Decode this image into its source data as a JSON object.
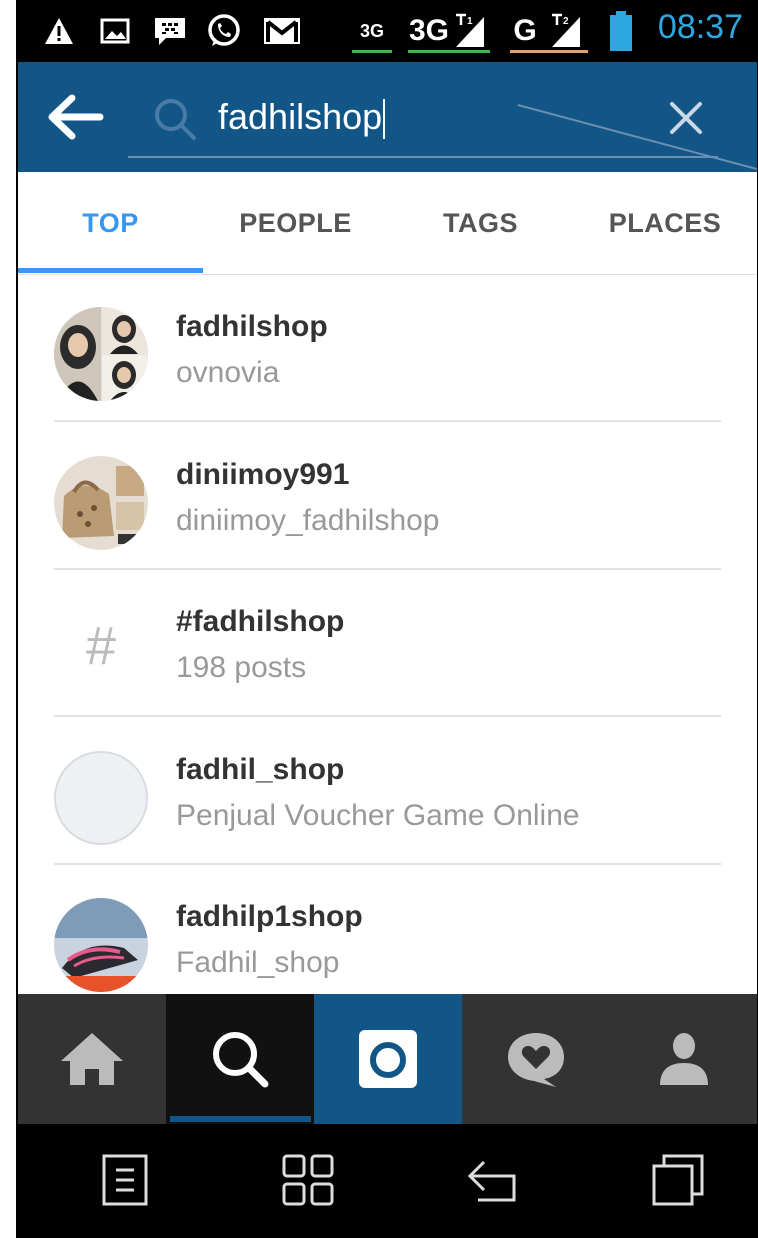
{
  "status_bar": {
    "network_labels": [
      "3G",
      "3G",
      "G"
    ],
    "sim_labels": [
      "1",
      "2"
    ],
    "time": "08:37"
  },
  "app_bar": {
    "search_value": "fadhilshop",
    "icons": {
      "back": "back-arrow-icon",
      "search": "search-icon",
      "clear": "close-icon"
    }
  },
  "tabs": [
    {
      "label": "TOP",
      "active": true
    },
    {
      "label": "PEOPLE",
      "active": false
    },
    {
      "label": "TAGS",
      "active": false
    },
    {
      "label": "PLACES",
      "active": false
    }
  ],
  "results": [
    {
      "title": "fadhilshop",
      "subtitle": "ovnovia",
      "kind": "user"
    },
    {
      "title": "diniimoy991",
      "subtitle": "diniimoy_fadhilshop",
      "kind": "user"
    },
    {
      "title": "#fadhilshop",
      "subtitle": "198 posts",
      "kind": "tag",
      "icon": "#"
    },
    {
      "title": "fadhil_shop",
      "subtitle": "Penjual Voucher Game Online",
      "kind": "user"
    },
    {
      "title": "fadhilp1shop",
      "subtitle": "Fadhil_shop",
      "kind": "user"
    }
  ],
  "bottom_nav": {
    "items": [
      "home-icon",
      "search-icon",
      "camera-icon",
      "activity-heart-icon",
      "profile-icon"
    ],
    "active": "search-icon"
  },
  "colors": {
    "app_bar": "#125688",
    "accent": "#3897f0",
    "clock": "#2ea7e0"
  }
}
